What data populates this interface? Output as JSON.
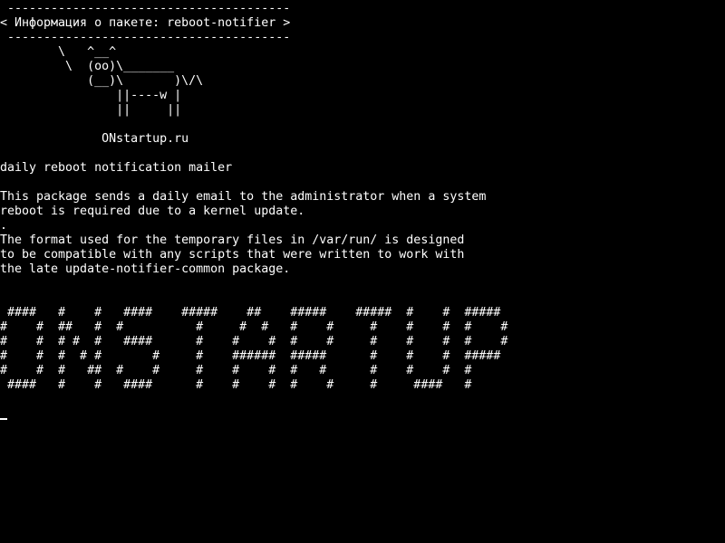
{
  "lines": [
    " ---------------------------------------",
    "< Информация о пакете: reboot-notifier >",
    " ---------------------------------------",
    "        \\   ^__^",
    "         \\  (oo)\\_______",
    "            (__)\\       )\\/\\",
    "                ||----w |",
    "                ||     ||",
    "",
    "              ONstartup.ru",
    "",
    "daily reboot notification mailer",
    "",
    "This package sends a daily email to the administrator when a system",
    "reboot is required due to a kernel update.",
    ".",
    "The format used for the temporary files in /var/run/ is designed",
    "to be compatible with any scripts that were written to work with",
    "the late update-notifier-common package.",
    "",
    "",
    " ####   #    #   ####    #####    ##    #####    #####  #    #  #####",
    "#    #  ##   #  #          #     #  #   #    #     #    #    #  #    #",
    "#    #  # #  #   ####      #    #    #  #    #     #    #    #  #    #",
    "#    #  #  # #       #     #    ######  #####      #    #    #  #####",
    "#    #  #   ##  #    #     #    #    #  #   #      #    #    #  #",
    " ####   #    #   ####      #    #    #  #    #     #     ####   #"
  ]
}
